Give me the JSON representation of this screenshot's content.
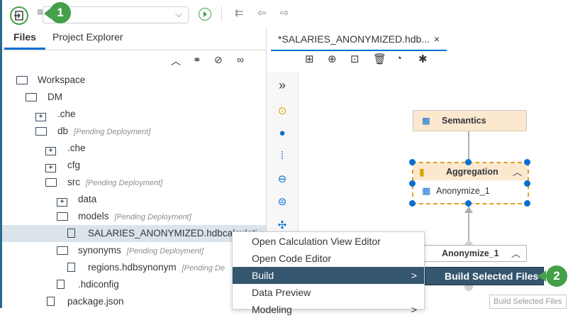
{
  "toolbar": {
    "icons": [
      "import-icon",
      "layers-icon",
      "chevron-down-icon",
      "run-icon",
      "step-back-icon",
      "arrow-left-icon",
      "arrow-right-icon"
    ]
  },
  "callouts": {
    "one": "1",
    "two": "2"
  },
  "left_panel": {
    "tabs": [
      "Files",
      "Project Explorer"
    ],
    "active_tab": "Files"
  },
  "tree": [
    {
      "label": "Workspace",
      "pending": ""
    },
    {
      "label": "DM",
      "pending": ""
    },
    {
      "label": ".che",
      "pending": ""
    },
    {
      "label": "db",
      "pending": "[Pending Deployment]"
    },
    {
      "label": ".che",
      "pending": ""
    },
    {
      "label": "cfg",
      "pending": ""
    },
    {
      "label": "src",
      "pending": "[Pending Deployment]"
    },
    {
      "label": "data",
      "pending": ""
    },
    {
      "label": "models",
      "pending": "[Pending Deployment]"
    },
    {
      "label": "SALARIES_ANONYMIZED.hdbcalculati",
      "pending": ""
    },
    {
      "label": "synonyms",
      "pending": "[Pending Deployment]"
    },
    {
      "label": "regions.hdbsynonym",
      "pending": "[Pending De"
    },
    {
      "label": ".hdiconfig",
      "pending": ""
    },
    {
      "label": "package.json",
      "pending": ""
    }
  ],
  "editor": {
    "tab_title": "*SALARIES_ANONYMIZED.hdb...",
    "close": "×"
  },
  "diagram": {
    "semantics": "Semantics",
    "aggregation": "Aggregation",
    "aggregation_input": "Anonymize_1",
    "anonymize": "Anonymize_1",
    "collapse": "^"
  },
  "context_menu": {
    "items": [
      "Open Calculation View Editor",
      "Open Code Editor",
      "Build",
      "Data Preview",
      "Modeling"
    ],
    "highlighted": "Build",
    "submenu_item": "Build Selected Files",
    "submenu_arrow": ">"
  },
  "tooltip": "Build Selected Files",
  "colors": {
    "accent": "#0a6ed1",
    "callout": "#45a04a",
    "menu_highlight": "#34566f",
    "node_header": "#fbe8cf"
  }
}
